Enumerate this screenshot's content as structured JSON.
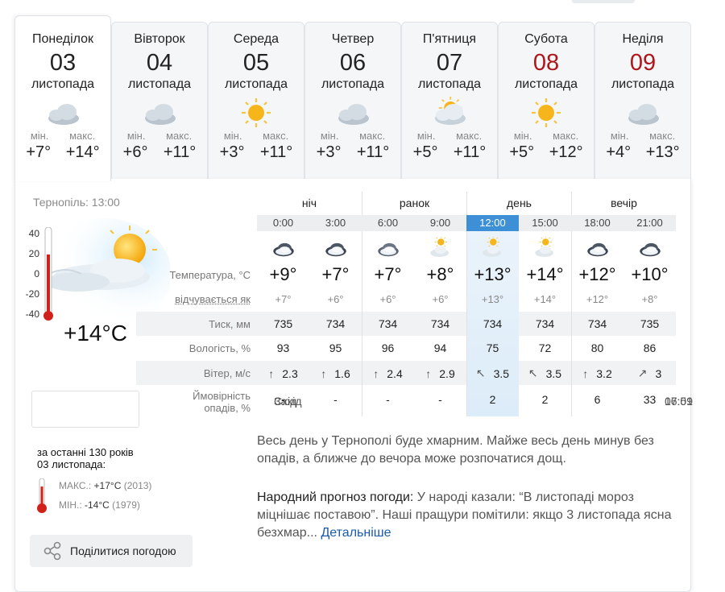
{
  "days": [
    {
      "name": "Понеділок",
      "num": "03",
      "month": "листопада",
      "icon": "cloudy-icon",
      "min_label": "мін.",
      "max_label": "макс.",
      "min": "+7°",
      "max": "+14°",
      "weekend": false,
      "active": true
    },
    {
      "name": "Вівторок",
      "num": "04",
      "month": "листопада",
      "icon": "cloudy-icon",
      "min_label": "мін.",
      "max_label": "макс.",
      "min": "+6°",
      "max": "+11°",
      "weekend": false,
      "active": false
    },
    {
      "name": "Середа",
      "num": "05",
      "month": "листопада",
      "icon": "sun-icon",
      "min_label": "мін.",
      "max_label": "макс.",
      "min": "+3°",
      "max": "+11°",
      "weekend": false,
      "active": false
    },
    {
      "name": "Четвер",
      "num": "06",
      "month": "листопада",
      "icon": "cloudy-icon",
      "min_label": "мін.",
      "max_label": "макс.",
      "min": "+3°",
      "max": "+11°",
      "weekend": false,
      "active": false
    },
    {
      "name": "П'ятниця",
      "num": "07",
      "month": "листопада",
      "icon": "partly-cloudy-icon",
      "min_label": "мін.",
      "max_label": "макс.",
      "min": "+5°",
      "max": "+11°",
      "weekend": false,
      "active": false
    },
    {
      "name": "Субота",
      "num": "08",
      "month": "листопада",
      "icon": "sun-icon",
      "min_label": "мін.",
      "max_label": "макс.",
      "min": "+5°",
      "max": "+12°",
      "weekend": true,
      "active": false
    },
    {
      "name": "Неділя",
      "num": "09",
      "month": "листопада",
      "icon": "cloudy-icon",
      "min_label": "мін.",
      "max_label": "макс.",
      "min": "+4°",
      "max": "+13°",
      "weekend": true,
      "active": false
    }
  ],
  "current": {
    "location": "Тернопіль: 13:00",
    "temp": "+14°C",
    "scale": [
      "40",
      "20",
      "0",
      "-20",
      "-40"
    ],
    "sunrise_label": "Схід",
    "sunrise": "07:09",
    "sunset_label": "Захід",
    "sunset": "16:51"
  },
  "history": {
    "title_line1": "за останні 130 років",
    "title_line2": "03 листопада:",
    "max_label": "МАКС.:",
    "max_value": "+17°C",
    "max_year": "(2013)",
    "min_label": "МІН.:",
    "min_value": "-14°C",
    "min_year": "(1979)"
  },
  "share_label": "Поділитися погодою",
  "periods": [
    "ніч",
    "ранок",
    "день",
    "вечір"
  ],
  "hours": [
    "0:00",
    "3:00",
    "6:00",
    "9:00",
    "12:00",
    "15:00",
    "18:00",
    "21:00"
  ],
  "current_hour_index": 4,
  "hour_icons": [
    "night-cloud-icon",
    "night-cloud-icon",
    "cloud-icon",
    "sun-cloud-icon",
    "sun-cloud-icon",
    "sun-cloud-icon",
    "night-cloud-icon",
    "night-cloud-icon"
  ],
  "labels": {
    "temp": "Температура, °C",
    "feel": "відчувається як",
    "pressure": "Тиск, мм",
    "humidity": "Вологість, %",
    "wind": "Вітер, м/с",
    "precip_1": "Ймовірність",
    "precip_2": "опадів, %"
  },
  "temps": [
    "+9°",
    "+7°",
    "+7°",
    "+8°",
    "+13°",
    "+14°",
    "+12°",
    "+10°"
  ],
  "feels": [
    "+7°",
    "+6°",
    "+6°",
    "+6°",
    "+13°",
    "+14°",
    "+12°",
    "+8°"
  ],
  "pressure": [
    "735",
    "734",
    "734",
    "734",
    "734",
    "734",
    "734",
    "735"
  ],
  "humidity": [
    "93",
    "95",
    "96",
    "94",
    "75",
    "72",
    "80",
    "86"
  ],
  "wind": [
    "2.3",
    "1.6",
    "2.4",
    "2.9",
    "3.5",
    "3.5",
    "3.2",
    "3"
  ],
  "wind_dir": [
    "↑",
    "↑",
    "↑",
    "↑",
    "↖",
    "↖",
    "↑",
    "↗"
  ],
  "precip": [
    "-",
    "-",
    "-",
    "-",
    "2",
    "2",
    "6",
    "33"
  ],
  "description": "Весь день у Тернополі буде хмарним. Майже весь день минув без опадів, а ближче до вечора може розпочатися дощ.",
  "folk_title": "Народний прогноз погоди:",
  "folk_text": " У народі казали: “В листопаді мороз міцнішає поставою”. Наші пращури помітили: якщо 3 листопада ясна безхмар... ",
  "folk_link": "Детальніше"
}
